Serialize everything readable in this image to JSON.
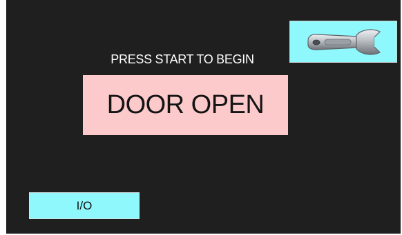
{
  "screen": {
    "background_color": "#1f1f1f"
  },
  "toolbar": {
    "service_button_icon": "wrench-icon",
    "button_color": "#8ef8fc"
  },
  "main": {
    "prompt_text": "PRESS START TO BEGIN",
    "status_text": "DOOR OPEN",
    "status_color": "#fccaca"
  },
  "footer": {
    "io_button_label": "I/O"
  }
}
